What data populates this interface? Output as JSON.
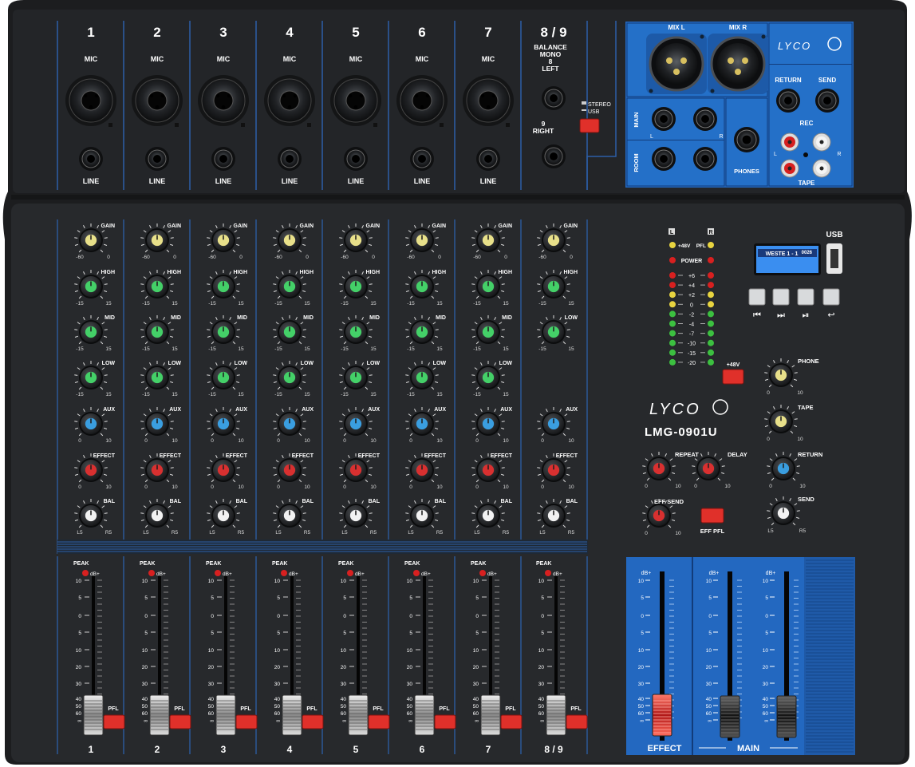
{
  "brand": "LYCO",
  "model": "LMG-0901U",
  "channels": [
    {
      "num": "1",
      "top": "MIC",
      "line": "LINE"
    },
    {
      "num": "2",
      "top": "MIC",
      "line": "LINE"
    },
    {
      "num": "3",
      "top": "MIC",
      "line": "LINE"
    },
    {
      "num": "4",
      "top": "MIC",
      "line": "LINE"
    },
    {
      "num": "5",
      "top": "MIC",
      "line": "LINE"
    },
    {
      "num": "6",
      "top": "MIC",
      "line": "LINE"
    },
    {
      "num": "7",
      "top": "MIC",
      "line": "LINE"
    },
    {
      "num": "8 / 9",
      "top": "BALANCE\nMONO\n8\nLEFT",
      "line": "9\nRIGHT"
    }
  ],
  "bottom_numbers": [
    "1",
    "2",
    "3",
    "4",
    "5",
    "6",
    "7",
    "8 / 9"
  ],
  "stereo_switch": {
    "stereo": "STEREO",
    "usb": "USB"
  },
  "rear_panel": {
    "mix_l": "MIX L",
    "mix_r": "MIX R",
    "main": "MAIN",
    "room": "ROOM",
    "l": "L",
    "r": "R",
    "phones": "PHONES",
    "return": "RETURN",
    "send": "SEND",
    "rec": "REC",
    "tape": "TAPE"
  },
  "knob_labels": {
    "gain": "GAIN",
    "high": "HIGH",
    "mid": "MID",
    "low": "LOW",
    "aux": "AUX",
    "effect": "EFFECT",
    "bal": "BAL",
    "gain_min": "-60",
    "gain_max": "0",
    "eq_min": "-15",
    "eq_max": "15",
    "lvl_min": "0",
    "lvl_max": "10",
    "bal_min": "L5",
    "bal_max": "R5"
  },
  "meter": {
    "l": "L",
    "r": "R",
    "phantom": "+48V",
    "pfl": "PFL",
    "power": "POWER",
    "steps": [
      "+6",
      "+4",
      "+2",
      "0",
      "-2",
      "-4",
      "-7",
      "-10",
      "-15",
      "-20"
    ]
  },
  "usb_player": {
    "usb": "USB",
    "display": "WESTE 1 - 1",
    "time": "0026",
    "buttons": [
      "⏮",
      "⏭",
      "⏯",
      "↩"
    ]
  },
  "master": {
    "phantom_btn": "+48V",
    "phone": "PHONE",
    "tape": "TAPE",
    "return": "RETURN",
    "send": "SEND",
    "repeat": "REPEAT",
    "delay": "DELAY",
    "eff_send": "EFF SEND",
    "eff_pfl": "EFF PFL"
  },
  "fader_scale": [
    "10",
    "5",
    "0",
    "5",
    "10",
    "20",
    "30",
    "40",
    "50",
    "60",
    "∞"
  ],
  "fader_labels": {
    "peak": "PEAK",
    "db": "dB+",
    "pfl": "PFL",
    "effect": "EFFECT",
    "main": "MAIN"
  },
  "colors": {
    "body": "#232527",
    "panel": "#2a2c2f",
    "blue": "#2368c0",
    "gain": "#e8e08a",
    "eq": "#44d068",
    "aux": "#3a9ee0",
    "fx": "#d83030",
    "bal": "#f2f2f2",
    "btn": "#e0302a"
  }
}
